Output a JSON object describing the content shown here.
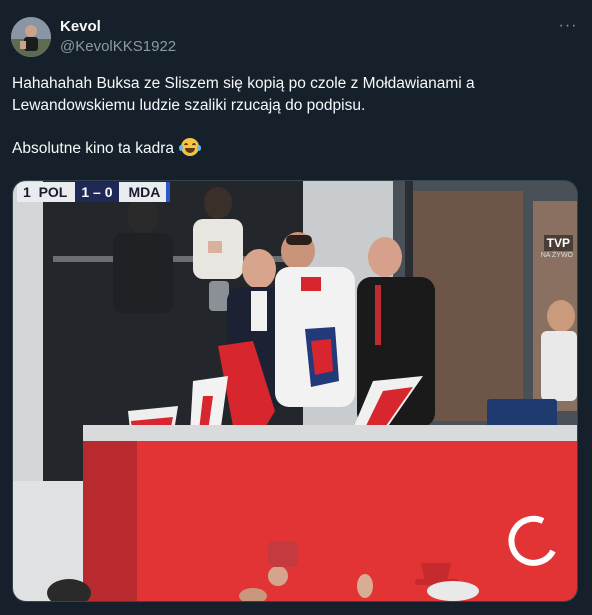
{
  "author": {
    "display_name": "Kevol",
    "handle": "@KevolKKS1922",
    "avatar_icon": "user-avatar"
  },
  "more_label": "···",
  "tweet": {
    "paragraph1": "Hahahahah Buksa ze Sliszem się kopią po czole z Mołdawianami a Lewandowskiemu ludzie szaliki rzucają do podpisu.",
    "paragraph2": "Absolutne kino ta kadra",
    "emoji": "face-with-tears-of-joy"
  },
  "media": {
    "scoreboard": {
      "period": "1",
      "home": "POL",
      "score": "1 – 0",
      "away": "MDA"
    },
    "broadcaster": "TVP",
    "broadcaster_sub": "NA ŻYWO"
  },
  "colors": {
    "background": "#15202b",
    "text": "#f7f9f9",
    "secondary": "#8b98a5",
    "scarf_red": "#d8262e"
  }
}
